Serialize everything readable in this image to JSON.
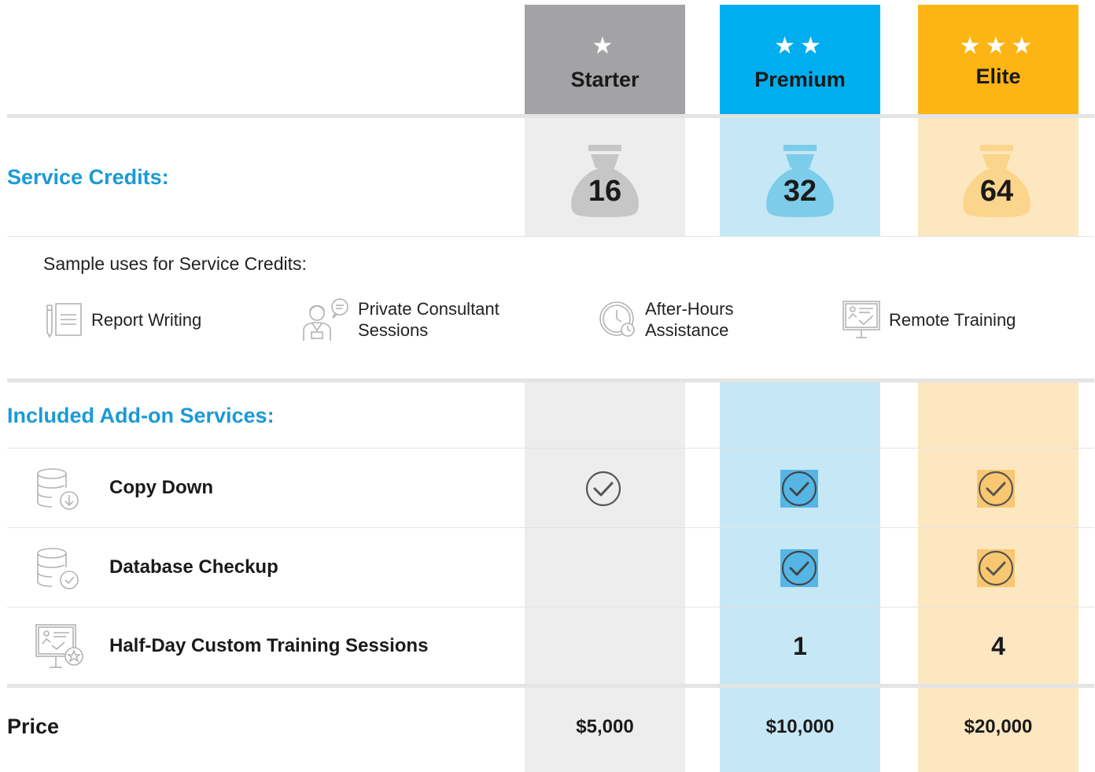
{
  "tiers": [
    {
      "key": "starter",
      "name": "Starter",
      "stars": "★",
      "credits": "16",
      "price": "$5,000",
      "copy_down": true,
      "database_checkup": false,
      "training_sessions": ""
    },
    {
      "key": "premium",
      "name": "Premium",
      "stars": "★★",
      "credits": "32",
      "price": "$10,000",
      "copy_down": true,
      "database_checkup": true,
      "training_sessions": "1"
    },
    {
      "key": "elite",
      "name": "Elite",
      "stars": "★★★",
      "credits": "64",
      "price": "$20,000",
      "copy_down": true,
      "database_checkup": true,
      "training_sessions": "4"
    }
  ],
  "service_credits": {
    "label": "Service Credits:"
  },
  "sample_uses": {
    "title": "Sample uses for Service Credits:",
    "items": [
      {
        "icon": "report-icon",
        "line1": "Report Writing",
        "line2": ""
      },
      {
        "icon": "consultant-icon",
        "line1": "Private Consultant",
        "line2": "Sessions"
      },
      {
        "icon": "clock-icon",
        "line1": "After-Hours",
        "line2": "Assistance"
      },
      {
        "icon": "presentation-icon",
        "line1": "Remote Training",
        "line2": ""
      }
    ]
  },
  "addons": {
    "label": "Included Add-on Services:",
    "rows": [
      {
        "icon": "database-download-icon",
        "label": "Copy Down"
      },
      {
        "icon": "database-check-icon",
        "label": "Database Checkup"
      },
      {
        "icon": "training-star-icon",
        "label": "Half-Day Custom Training Sessions"
      }
    ]
  },
  "price": {
    "label": "Price"
  },
  "colors": {
    "starter": "#a3a3a6",
    "premium": "#00aeef",
    "elite": "#fdb515",
    "section_label": "#1b9ad6"
  }
}
